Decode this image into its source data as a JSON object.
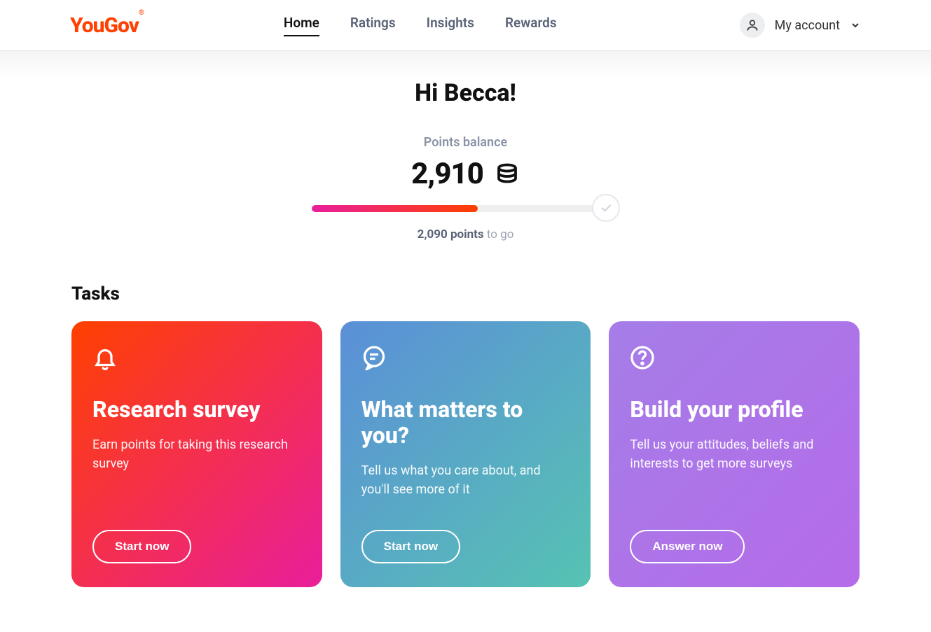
{
  "brand": "YouGov",
  "nav": {
    "items": [
      "Home",
      "Ratings",
      "Insights",
      "Rewards"
    ],
    "active_index": 0
  },
  "account": {
    "label": "My account"
  },
  "greeting": "Hi Becca!",
  "points": {
    "label": "Points balance",
    "value": "2,910",
    "to_go_value": "2,090 points",
    "to_go_suffix": " to go",
    "progress_percent": 58
  },
  "tasks": {
    "heading": "Tasks",
    "cards": [
      {
        "icon": "bell-icon",
        "title": "Research survey",
        "desc": "Earn points for taking this research survey",
        "button": "Start now"
      },
      {
        "icon": "chat-icon",
        "title": "What matters to you?",
        "desc": "Tell us what you care about, and you'll see more of it",
        "button": "Start now"
      },
      {
        "icon": "question-icon",
        "title": "Build your profile",
        "desc": "Tell us your attitudes, beliefs and interests to get more surveys",
        "button": "Answer now"
      }
    ]
  }
}
